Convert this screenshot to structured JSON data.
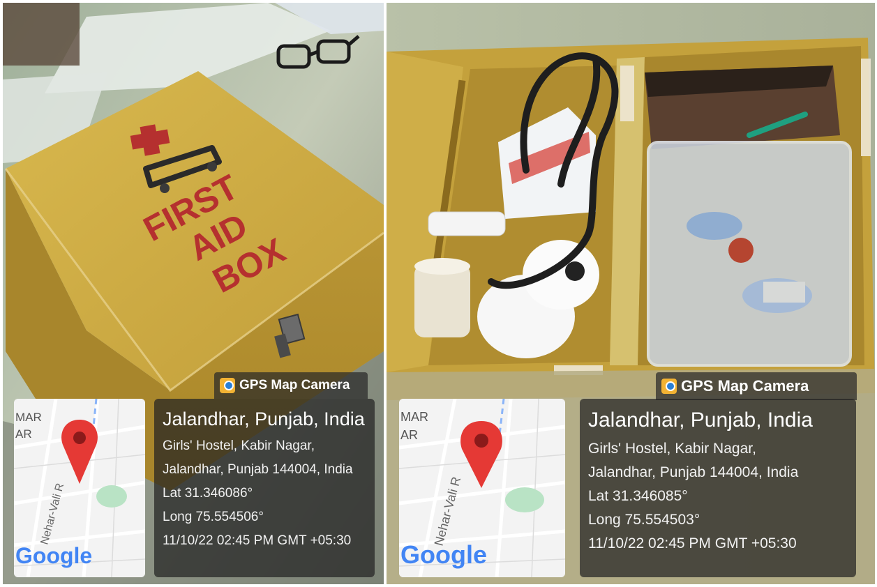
{
  "panels": [
    {
      "gps_label": "GPS Map Camera",
      "box_label": {
        "line1": "FIRST",
        "line2": "AID",
        "line3": "BOX"
      },
      "map": {
        "area_label_top": "MAR",
        "area_label_mid": "AR",
        "road_name": "Nehar-Vali R",
        "brand": "Google"
      },
      "location_title": "Jalandhar, Punjab, India",
      "address_line1": "Girls' Hostel, Kabir Nagar,",
      "address_line2": "Jalandhar, Punjab 144004, India",
      "lat": "Lat 31.346086°",
      "long": "Long 75.554506°",
      "datetime": "11/10/22 02:45 PM GMT +05:30"
    },
    {
      "gps_label": "GPS Map Camera",
      "map": {
        "area_label_top": "MAR",
        "area_label_mid": "AR",
        "road_name": "Nehar-Vali R",
        "brand": "Google"
      },
      "location_title": "Jalandhar, Punjab, India",
      "address_line1": "Girls' Hostel, Kabir Nagar,",
      "address_line2": "Jalandhar, Punjab 144004, India",
      "lat": "Lat 31.346085°",
      "long": "Long 75.554503°",
      "datetime": "11/10/22 02:45 PM GMT +05:30"
    }
  ],
  "colors": {
    "box_paint": "#c9a53e",
    "label_red": "#b5302f",
    "pin_red": "#e53935",
    "google_blue": "#4285f4",
    "google_red": "#ea4335",
    "google_yellow": "#fbbc05",
    "google_green": "#34a853"
  }
}
